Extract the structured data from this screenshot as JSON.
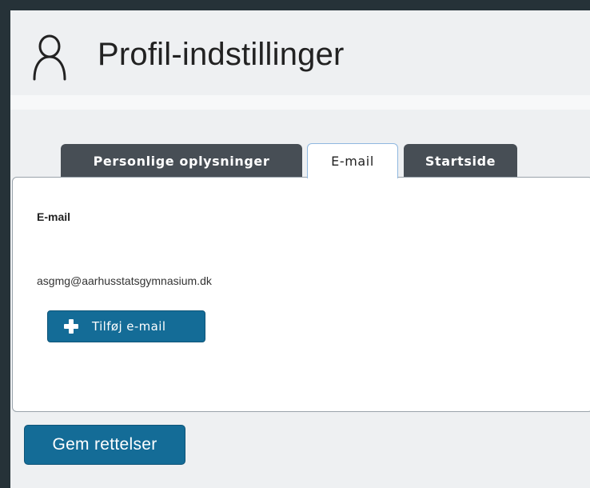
{
  "header": {
    "title": "Profil-indstillinger",
    "icon": "user-icon"
  },
  "tabs": [
    {
      "label": "Personlige oplysninger",
      "active": false
    },
    {
      "label": "E-mail",
      "active": true
    },
    {
      "label": "Startside",
      "active": false
    }
  ],
  "email_section": {
    "label": "E-mail",
    "address": "asgmg@aarhusstatsgymnasium.dk",
    "add_button_label": "Tilføj e-mail",
    "add_button_icon": "plus-icon"
  },
  "save_button_label": "Gem rettelser",
  "colors": {
    "accent": "#146c97",
    "tab_dark": "#474e55",
    "frame": "#263238",
    "panel": "#eef0f2"
  }
}
